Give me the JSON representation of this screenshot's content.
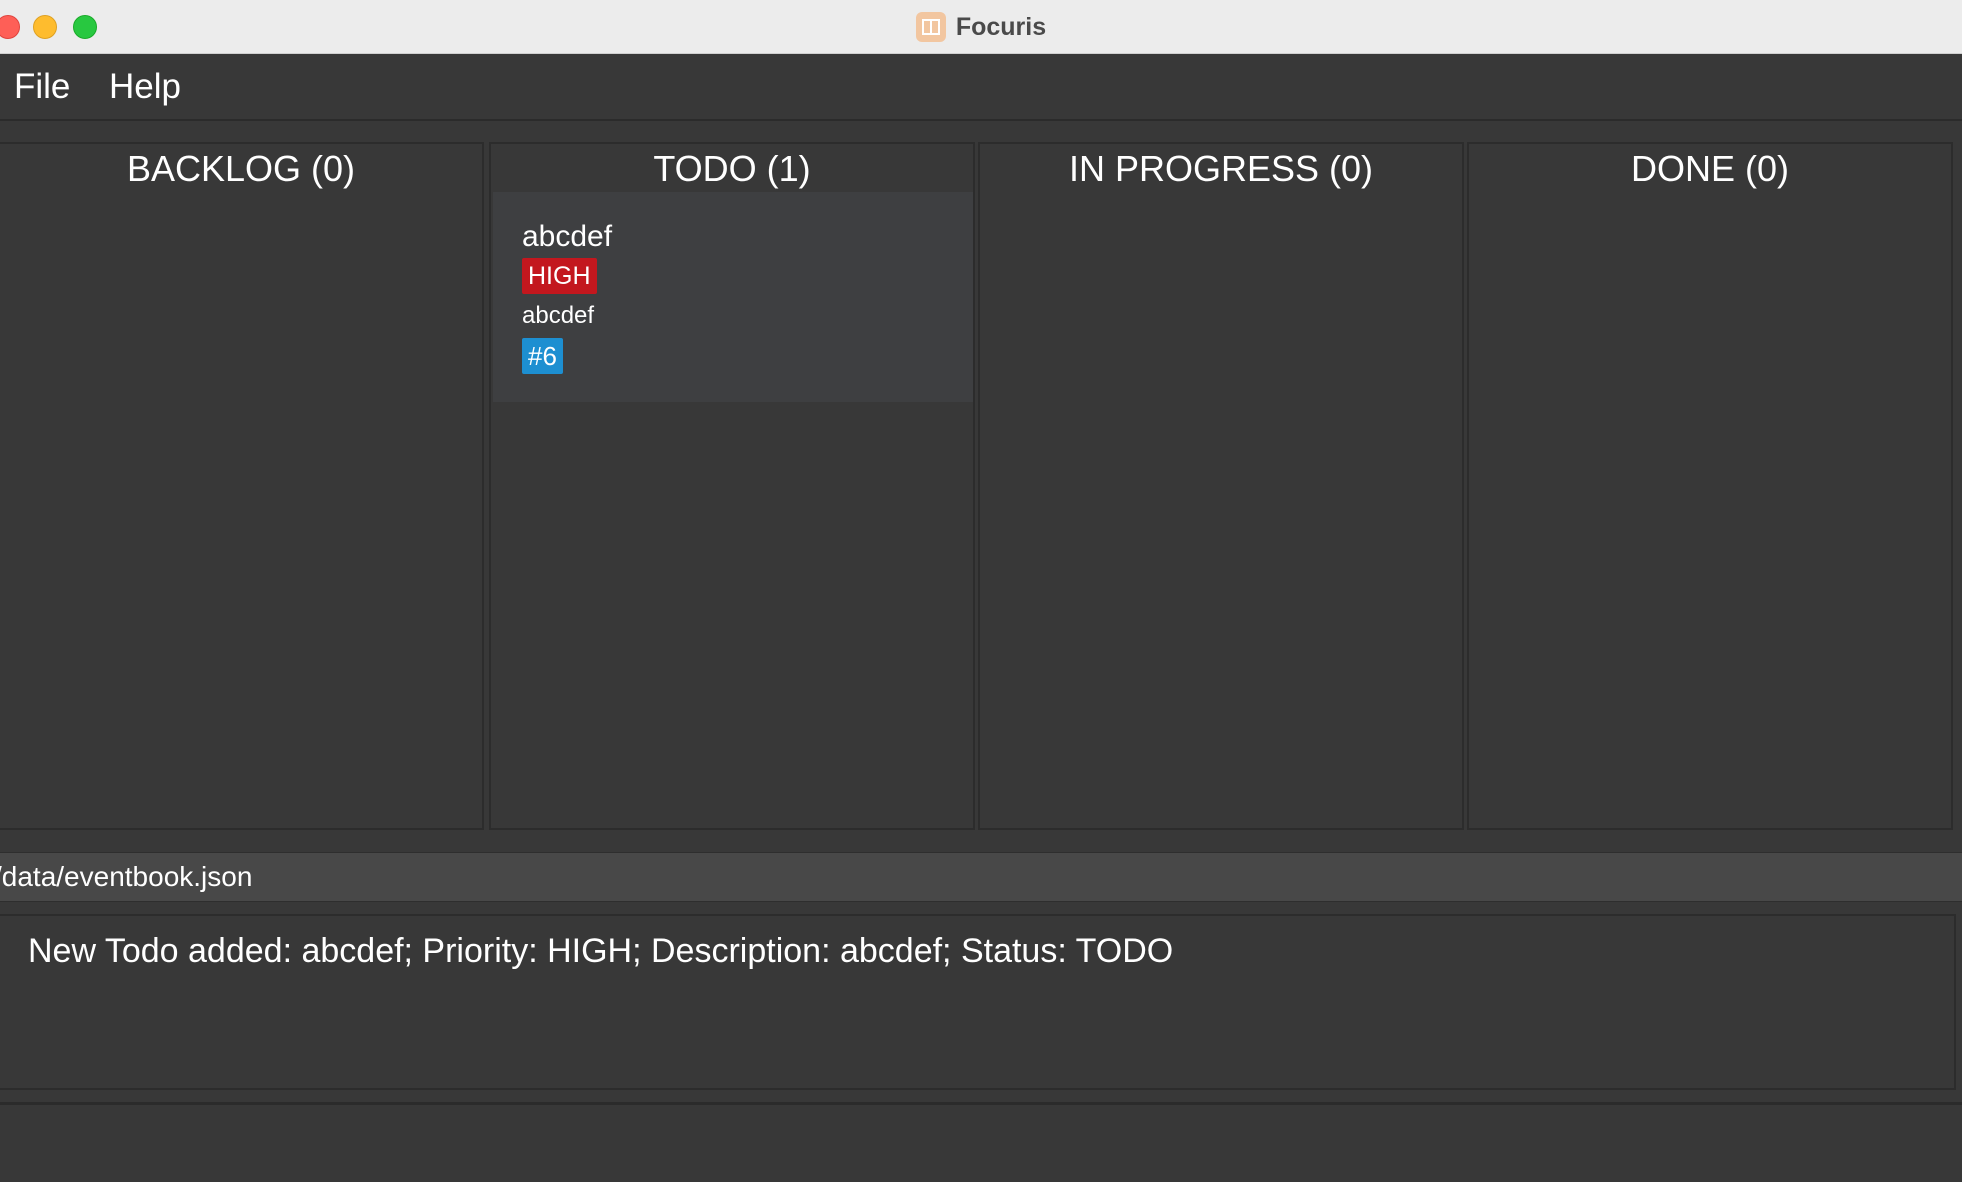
{
  "window": {
    "title": "Focuris"
  },
  "menu": {
    "file": "File",
    "help": "Help"
  },
  "columns": {
    "backlog": {
      "header": "BACKLOG (0)"
    },
    "todo": {
      "header": "TODO (1)",
      "cards": [
        {
          "title": "abcdef",
          "priority": "HIGH",
          "description": "abcdef",
          "id": "#6"
        }
      ]
    },
    "inprogress": {
      "header": "IN PROGRESS (0)"
    },
    "done": {
      "header": "DONE (0)"
    }
  },
  "status": {
    "path": "/data/eventbook.json"
  },
  "result": {
    "message": "New Todo added: abcdef; Priority: HIGH; Description: abcdef; Status: TODO"
  },
  "colors": {
    "background": "#383838",
    "priority_high": "#c3171e",
    "id_badge": "#1d8fd1",
    "card": "#3e3f41"
  }
}
